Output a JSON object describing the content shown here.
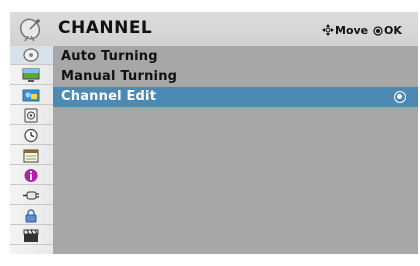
{
  "header": {
    "title": "CHANNEL",
    "icon": "satellite-dish-icon",
    "hints": {
      "move_label": "Move",
      "ok_label": "OK"
    }
  },
  "sidebar": {
    "items": [
      {
        "icon": "dish-icon",
        "active": true
      },
      {
        "icon": "monitor-picture-icon",
        "active": false
      },
      {
        "icon": "screen-photo-icon",
        "active": false
      },
      {
        "icon": "speaker-icon",
        "active": false
      },
      {
        "icon": "clock-icon",
        "active": false
      },
      {
        "icon": "calendar-icon",
        "active": false
      },
      {
        "icon": "info-icon",
        "active": false
      },
      {
        "icon": "plug-icon",
        "active": false
      },
      {
        "icon": "lock-icon",
        "active": false
      },
      {
        "icon": "clapperboard-icon",
        "active": false
      }
    ]
  },
  "menu": {
    "items": [
      {
        "label": "Auto Turning",
        "selected": false
      },
      {
        "label": "Manual Turning",
        "selected": false
      },
      {
        "label": "Channel Edit",
        "selected": true
      }
    ]
  },
  "colors": {
    "background": "#a8a7a7",
    "header": "#d6d6d6",
    "selection": "#4c8ab4",
    "sidebar": "#efefef"
  }
}
